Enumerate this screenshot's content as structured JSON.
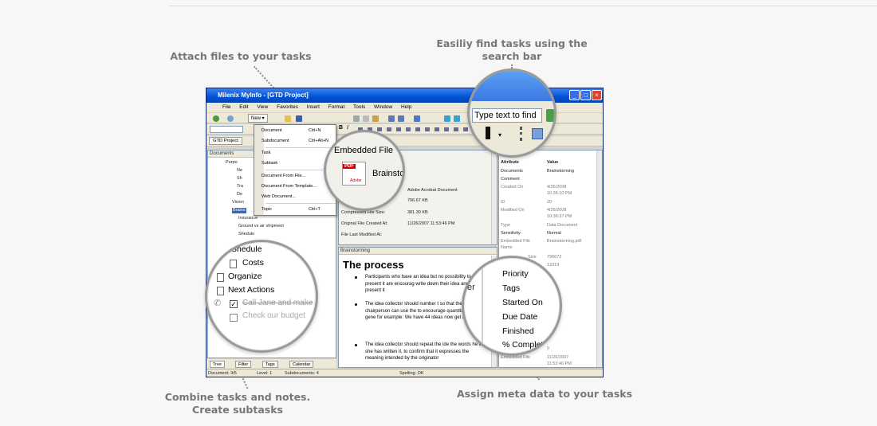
{
  "captions": {
    "attach": "Attach files to your tasks",
    "search_line1": "Easiliy find tasks using the",
    "search_line2": "search bar",
    "combine_line1": "Combine tasks and notes.",
    "combine_line2": "Create subtasks",
    "meta": "Assign meta data to your tasks"
  },
  "window": {
    "title": "Milenix Mylnfo - [GTD Project]",
    "menus": [
      "File",
      "Edit",
      "View",
      "Favorites",
      "Insert",
      "Format",
      "Tools",
      "Window",
      "Help"
    ],
    "new_button": "New",
    "project_button": "GTD Project",
    "documents_label": "Documents"
  },
  "new_menu": {
    "items": [
      {
        "label": "Document",
        "shortcut": "Ctrl+N"
      },
      {
        "label": "Subdocument",
        "shortcut": "Ctrl+Alt+N"
      },
      {
        "label": "Task",
        "shortcut": ""
      },
      {
        "label": "Subtask",
        "shortcut": ""
      },
      {
        "label": "Document From File...",
        "shortcut": ""
      },
      {
        "label": "Document From Template...",
        "shortcut": ""
      },
      {
        "label": "Web Document...",
        "shortcut": ""
      },
      {
        "label": "Topic",
        "shortcut": "Ctrl+T"
      }
    ]
  },
  "tree": {
    "items": [
      "Purpo",
      "Ne",
      "Sh",
      "Tra",
      "De",
      "Vision",
      "Brains",
      "Insurance",
      "Ground vs air shipment",
      "Shedule"
    ]
  },
  "tree_lens": {
    "items": [
      "Shedule",
      "Costs",
      "Organize",
      "Next Actions",
      "Call Jane and make",
      "Check our budget"
    ]
  },
  "file_panel": {
    "header": "Embedded File",
    "file_name": "Brainstc",
    "pdf_label": "PDF",
    "adobe_label": "Adobe",
    "rows": [
      {
        "label": "",
        "value": "Adobe Acrobat Document"
      },
      {
        "label": "",
        "value": "796.67 KB"
      },
      {
        "label": "Compressed File Size:",
        "value": "381.30 KB"
      },
      {
        "label": "Original File Created At:",
        "value": "11/26/2007 11:53:46 PM"
      },
      {
        "label": "File Last Modified At:",
        "value": ""
      }
    ]
  },
  "editor": {
    "pane_title": "Brainstorming",
    "heading": "The process",
    "bullets": [
      "Participants who have an idea but no possibility to present it are encourag write down their idea and present it",
      "The idea collector should number t so that the chairperson can use the to encourage quantitative idea gene for example: We have 44 ideas now get it to 50!",
      "The idea collector should repeat the ide the words he or she has written it, to confirm that it expresses the meaning intended by the originator"
    ],
    "ghost": "er"
  },
  "search": {
    "placeholder": "Type text to find"
  },
  "attributes": {
    "header": [
      "Attribute",
      "Value"
    ],
    "rows": [
      [
        "Documents",
        "Brainstorming"
      ],
      [
        "Comment",
        ""
      ],
      [
        "Created On",
        "4/26/2008"
      ],
      [
        "",
        "10:36:10 PM"
      ],
      [
        "ID",
        "20"
      ],
      [
        "Modified On",
        "4/26/2008"
      ],
      [
        "",
        "10:36:37 PM"
      ],
      [
        "Type",
        "Data Document"
      ],
      [
        "Sensitivity",
        "Normal"
      ],
      [
        "Embedded File",
        "Brainstorming.pdf"
      ],
      [
        "Name",
        ""
      ],
      [
        "Size",
        "796672"
      ],
      [
        "",
        "13319"
      ]
    ],
    "bottom_rows": [
      [
        "",
        "0"
      ],
      [
        "Embedded File",
        "11/26/2007"
      ],
      [
        "",
        "11:53:46 PM"
      ]
    ]
  },
  "meta_lens": {
    "items": [
      "Priority",
      "Tags",
      "Started On",
      "Due Date",
      "Finished",
      "% Complet"
    ]
  },
  "tabs": [
    "Tree",
    "Filter",
    "Tags",
    "Calendar"
  ],
  "status": {
    "document": "Document: 3/5",
    "level": "Level: 1",
    "subdocuments": "Subdocuments: 4",
    "spelling": "Spelling: OK"
  }
}
